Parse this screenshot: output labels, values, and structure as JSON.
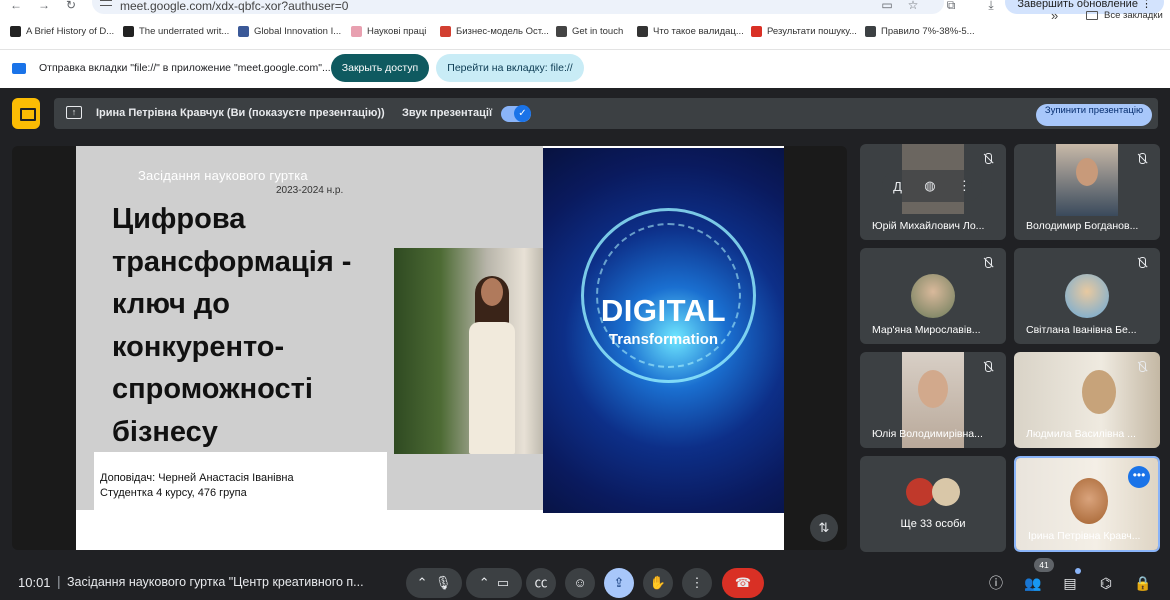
{
  "browser": {
    "url": "meet.google.com/xdx-qbfc-xor?authuser=0",
    "update_button": "Завершить обновление",
    "bookmarks": [
      {
        "label": "A Brief History of D...",
        "color": "#222222"
      },
      {
        "label": "The underrated writ...",
        "color": "#222222"
      },
      {
        "label": "Global Innovation I...",
        "color": "#3b5998"
      },
      {
        "label": "Наукові праці",
        "color": "#e8a0b0"
      },
      {
        "label": "Бизнес-модель Ост...",
        "color": "#d23f31"
      },
      {
        "label": "Get in touch",
        "color": "#444444"
      },
      {
        "label": "Что такое валидац...",
        "color": "#333333"
      },
      {
        "label": "Результати пошуку...",
        "color": "#d93025"
      },
      {
        "label": "Правило 7%-38%-5...",
        "color": "#3c4043"
      }
    ],
    "bookmarks_more": "»",
    "all_bookmarks": "Все закладки",
    "infobar": {
      "text": "Отправка вкладки \"file://\" в приложение \"meet.google.com\"...",
      "close_access": "Закрыть доступ",
      "goto_tab": "Перейти на вкладку: file://"
    }
  },
  "meet": {
    "presenting_bar": {
      "presenter_text": "Ірина Петрівна Кравчук (Ви (показуєте презентацію))",
      "sound_label": "Звук презентації",
      "sound_on": true,
      "stop_button": "Зупинити презентацію"
    },
    "slide": {
      "header": "Засідання наукового гуртка",
      "year": "2023-2024 н.р.",
      "title": "Цифрова трансформація - ключ до конкуренто-спроможності бізнесу",
      "speaker_line1": "Доповідач: Черней Анастасія Іванівна",
      "speaker_line2": "Студентка 4 курсу, 476 група",
      "digital_word": "DIGITAL",
      "digital_sub": "Transformation"
    },
    "participants": [
      {
        "name": "Юрій Михайлович Ло..."
      },
      {
        "name": "Володимир Богданов..."
      },
      {
        "name": "Мар'яна Мирославів..."
      },
      {
        "name": "Світлана Іванівна Бе..."
      },
      {
        "name": "Юлія Володимирівна..."
      },
      {
        "name": "Людмила Василівна ..."
      }
    ],
    "more_people": "Ще 33 особи",
    "self_tile_name": "Ірина Петрівна Кравч...",
    "bottom": {
      "time": "10:01",
      "separator": "|",
      "meeting_title": "Засідання наукового гуртка \"Центр креативного п...",
      "people_count": "41"
    }
  }
}
